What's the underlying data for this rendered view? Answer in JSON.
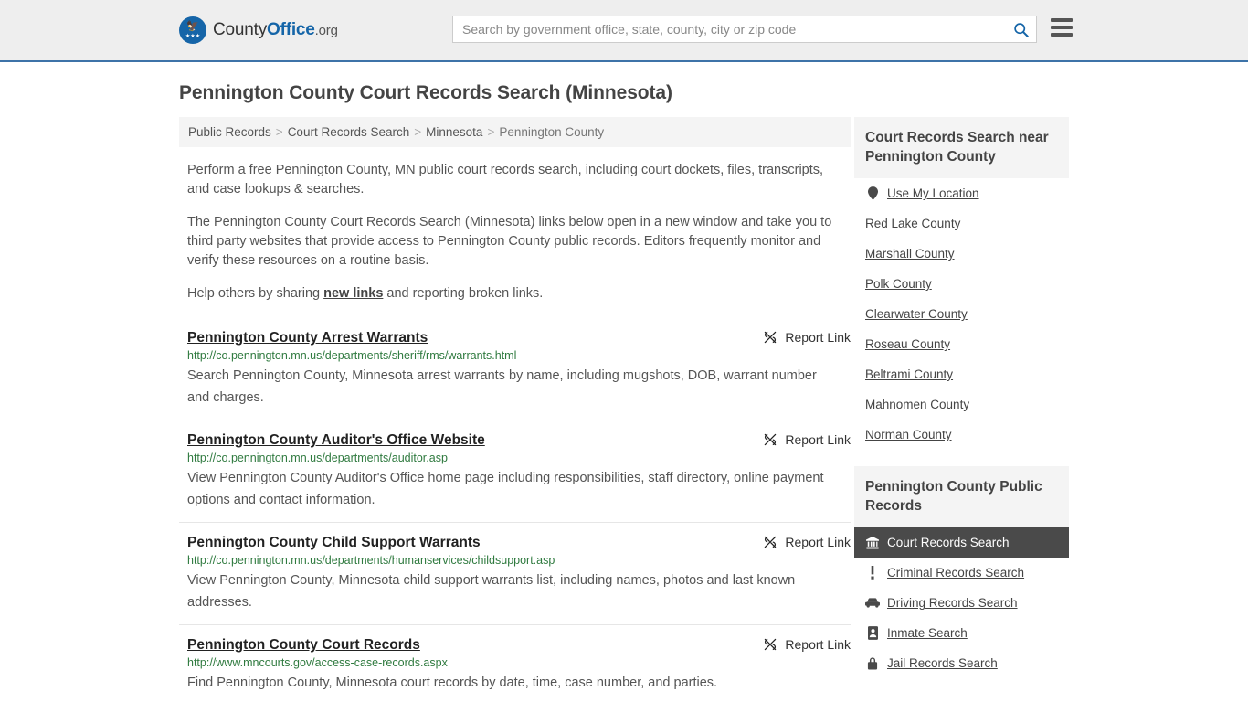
{
  "header": {
    "brand": {
      "part1": "County",
      "part2": "Office",
      "part3": ".org",
      "logo_icon": "eagle-seal-icon"
    },
    "search": {
      "placeholder": "Search by government office, state, county, city or zip code",
      "value": "",
      "icon": "search-icon"
    },
    "menu_icon": "hamburger-menu-icon",
    "accent_color": "#3d73a8"
  },
  "page": {
    "title": "Pennington County Court Records Search (Minnesota)"
  },
  "breadcrumb": {
    "items": [
      {
        "label": "Public Records",
        "current": false
      },
      {
        "label": "Court Records Search",
        "current": false
      },
      {
        "label": "Minnesota",
        "current": false
      },
      {
        "label": "Pennington County",
        "current": true
      }
    ],
    "separator": ">"
  },
  "intro": {
    "p1": "Perform a free Pennington County, MN public court records search, including court dockets, files, transcripts, and case lookups & searches.",
    "p2": "The Pennington County Court Records Search (Minnesota) links below open in a new window and take you to third party websites that provide access to Pennington County public records. Editors frequently monitor and verify these resources on a routine basis.",
    "p3_before": "Help others by sharing ",
    "p3_link": "new links",
    "p3_after": " and reporting broken links."
  },
  "results": {
    "report_label": "Report Link",
    "report_icon": "broken-link-icon",
    "items": [
      {
        "title": "Pennington County Arrest Warrants",
        "url": "http://co.pennington.mn.us/departments/sheriff/rms/warrants.html",
        "description": "Search Pennington County, Minnesota arrest warrants by name, including mugshots, DOB, warrant number and charges."
      },
      {
        "title": "Pennington County Auditor's Office Website",
        "url": "http://co.pennington.mn.us/departments/auditor.asp",
        "description": "View Pennington County Auditor's Office home page including responsibilities, staff directory, online payment options and contact information."
      },
      {
        "title": "Pennington County Child Support Warrants",
        "url": "http://co.pennington.mn.us/departments/humanservices/childsupport.asp",
        "description": "View Pennington County, Minnesota child support warrants list, including names, photos and last known addresses."
      },
      {
        "title": "Pennington County Court Records",
        "url": "http://www.mncourts.gov/access-case-records.aspx",
        "description": "Find Pennington County, Minnesota court records by date, time, case number, and parties."
      }
    ]
  },
  "sidebar": {
    "nearby": {
      "heading": "Court Records Search near Pennington County",
      "items": [
        {
          "label": "Use My Location",
          "icon": "map-pin-icon",
          "active": false
        },
        {
          "label": "Red Lake County",
          "icon": "",
          "active": false
        },
        {
          "label": "Marshall County",
          "icon": "",
          "active": false
        },
        {
          "label": "Polk County",
          "icon": "",
          "active": false
        },
        {
          "label": "Clearwater County",
          "icon": "",
          "active": false
        },
        {
          "label": "Roseau County",
          "icon": "",
          "active": false
        },
        {
          "label": "Beltrami County",
          "icon": "",
          "active": false
        },
        {
          "label": "Mahnomen County",
          "icon": "",
          "active": false
        },
        {
          "label": "Norman County",
          "icon": "",
          "active": false
        }
      ]
    },
    "public_records": {
      "heading": "Pennington County Public Records",
      "active_background": "#4a4a4a",
      "items": [
        {
          "label": "Court Records Search",
          "icon": "courthouse-icon",
          "active": true
        },
        {
          "label": "Criminal Records Search",
          "icon": "exclamation-icon",
          "active": false
        },
        {
          "label": "Driving Records Search",
          "icon": "car-icon",
          "active": false
        },
        {
          "label": "Inmate Search",
          "icon": "id-card-icon",
          "active": false
        },
        {
          "label": "Jail Records Search",
          "icon": "lock-icon",
          "active": false
        }
      ]
    }
  }
}
